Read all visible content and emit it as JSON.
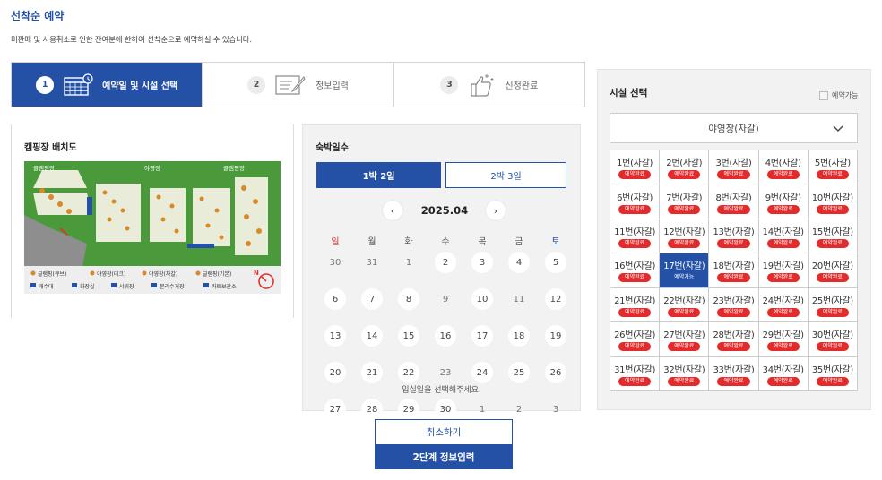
{
  "page": {
    "title": "선착순 예약",
    "subtitle": "미판매 및 사용취소로 인한 잔여분에 한하여 선착순으로 예약하실 수 있습니다."
  },
  "steps": [
    {
      "num": "1",
      "label": "예약일 및 시설 선택",
      "active": true
    },
    {
      "num": "2",
      "label": "정보입력",
      "active": false
    },
    {
      "num": "3",
      "label": "신청완료",
      "active": false
    }
  ],
  "map": {
    "title": "캠핑장 배치도",
    "labels": [
      "글램핑장",
      "야영장",
      "글램핑장"
    ],
    "legend": [
      "글램핑(큐브)",
      "야영장(데크)",
      "야영장(자갈)",
      "글램핑(기본)",
      "개수대",
      "화장실",
      "샤워장",
      "분리수거장",
      "카트보관소"
    ],
    "compass": "N"
  },
  "calendar": {
    "title": "숙박일수",
    "nights": [
      "1박 2일",
      "2박 3일"
    ],
    "selected_night": 0,
    "month": "2025.04",
    "prev_icon": "chevron-left-icon",
    "next_icon": "chevron-right-icon",
    "weekdays": [
      "일",
      "월",
      "화",
      "수",
      "목",
      "금",
      "토"
    ],
    "weeks": [
      [
        {
          "d": "30",
          "a": false
        },
        {
          "d": "31",
          "a": false
        },
        {
          "d": "1",
          "a": false
        },
        {
          "d": "2",
          "a": true
        },
        {
          "d": "3",
          "a": true
        },
        {
          "d": "4",
          "a": true
        },
        {
          "d": "5",
          "a": true
        }
      ],
      [
        {
          "d": "6",
          "a": true
        },
        {
          "d": "7",
          "a": true
        },
        {
          "d": "8",
          "a": true
        },
        {
          "d": "9",
          "a": false
        },
        {
          "d": "10",
          "a": true
        },
        {
          "d": "11",
          "a": false
        },
        {
          "d": "12",
          "a": true
        }
      ],
      [
        {
          "d": "13",
          "a": true
        },
        {
          "d": "14",
          "a": true
        },
        {
          "d": "15",
          "a": true
        },
        {
          "d": "16",
          "a": true
        },
        {
          "d": "17",
          "a": true
        },
        {
          "d": "18",
          "a": true
        },
        {
          "d": "19",
          "a": true
        }
      ],
      [
        {
          "d": "20",
          "a": true
        },
        {
          "d": "21",
          "a": true
        },
        {
          "d": "22",
          "a": true
        },
        {
          "d": "23",
          "a": false
        },
        {
          "d": "24",
          "a": true
        },
        {
          "d": "25",
          "a": true
        },
        {
          "d": "26",
          "a": true
        }
      ],
      [
        {
          "d": "27",
          "a": true
        },
        {
          "d": "28",
          "a": true
        },
        {
          "d": "29",
          "a": true
        },
        {
          "d": "30",
          "a": true
        },
        {
          "d": "1",
          "a": false
        },
        {
          "d": "2",
          "a": false
        },
        {
          "d": "3",
          "a": false
        }
      ]
    ],
    "hint": "입실일을 선택해주세요."
  },
  "actions": {
    "cancel": "취소하기",
    "next": "2단계 정보입력"
  },
  "facility": {
    "title": "시설 선택",
    "legend": "예약가능",
    "selected": "야영장(자갈)",
    "chevron_icon": "chevron-down-icon",
    "sites": [
      {
        "name": "1번(자갈)",
        "status": "예약완료"
      },
      {
        "name": "2번(자갈)",
        "status": "예약완료"
      },
      {
        "name": "3번(자갈)",
        "status": "예약완료"
      },
      {
        "name": "4번(자갈)",
        "status": "예약완료"
      },
      {
        "name": "5번(자갈)",
        "status": "예약완료"
      },
      {
        "name": "6번(자갈)",
        "status": "예약완료"
      },
      {
        "name": "7번(자갈)",
        "status": "예약완료"
      },
      {
        "name": "8번(자갈)",
        "status": "예약완료"
      },
      {
        "name": "9번(자갈)",
        "status": "예약완료"
      },
      {
        "name": "10번(자갈)",
        "status": "예약완료"
      },
      {
        "name": "11번(자갈)",
        "status": "예약완료"
      },
      {
        "name": "12번(자갈)",
        "status": "예약완료"
      },
      {
        "name": "13번(자갈)",
        "status": "예약완료"
      },
      {
        "name": "14번(자갈)",
        "status": "예약완료"
      },
      {
        "name": "15번(자갈)",
        "status": "예약완료"
      },
      {
        "name": "16번(자갈)",
        "status": "예약완료"
      },
      {
        "name": "17번(자갈)",
        "status": "예약가능",
        "selected": true
      },
      {
        "name": "18번(자갈)",
        "status": "예약완료"
      },
      {
        "name": "19번(자갈)",
        "status": "예약완료"
      },
      {
        "name": "20번(자갈)",
        "status": "예약완료"
      },
      {
        "name": "21번(자갈)",
        "status": "예약완료"
      },
      {
        "name": "22번(자갈)",
        "status": "예약완료"
      },
      {
        "name": "23번(자갈)",
        "status": "예약완료"
      },
      {
        "name": "24번(자갈)",
        "status": "예약완료"
      },
      {
        "name": "25번(자갈)",
        "status": "예약완료"
      },
      {
        "name": "26번(자갈)",
        "status": "예약완료"
      },
      {
        "name": "27번(자갈)",
        "status": "예약완료"
      },
      {
        "name": "28번(자갈)",
        "status": "예약완료"
      },
      {
        "name": "29번(자갈)",
        "status": "예약완료"
      },
      {
        "name": "30번(자갈)",
        "status": "예약완료"
      },
      {
        "name": "31번(자갈)",
        "status": "예약완료"
      },
      {
        "name": "32번(자갈)",
        "status": "예약완료"
      },
      {
        "name": "33번(자갈)",
        "status": "예약완료"
      },
      {
        "name": "34번(자갈)",
        "status": "예약완료"
      },
      {
        "name": "35번(자갈)",
        "status": "예약완료"
      }
    ]
  },
  "colors": {
    "brand": "#2451a6",
    "badge": "#e32b2b",
    "sunday": "#e0332b",
    "map_green": "#4a9a3b"
  }
}
